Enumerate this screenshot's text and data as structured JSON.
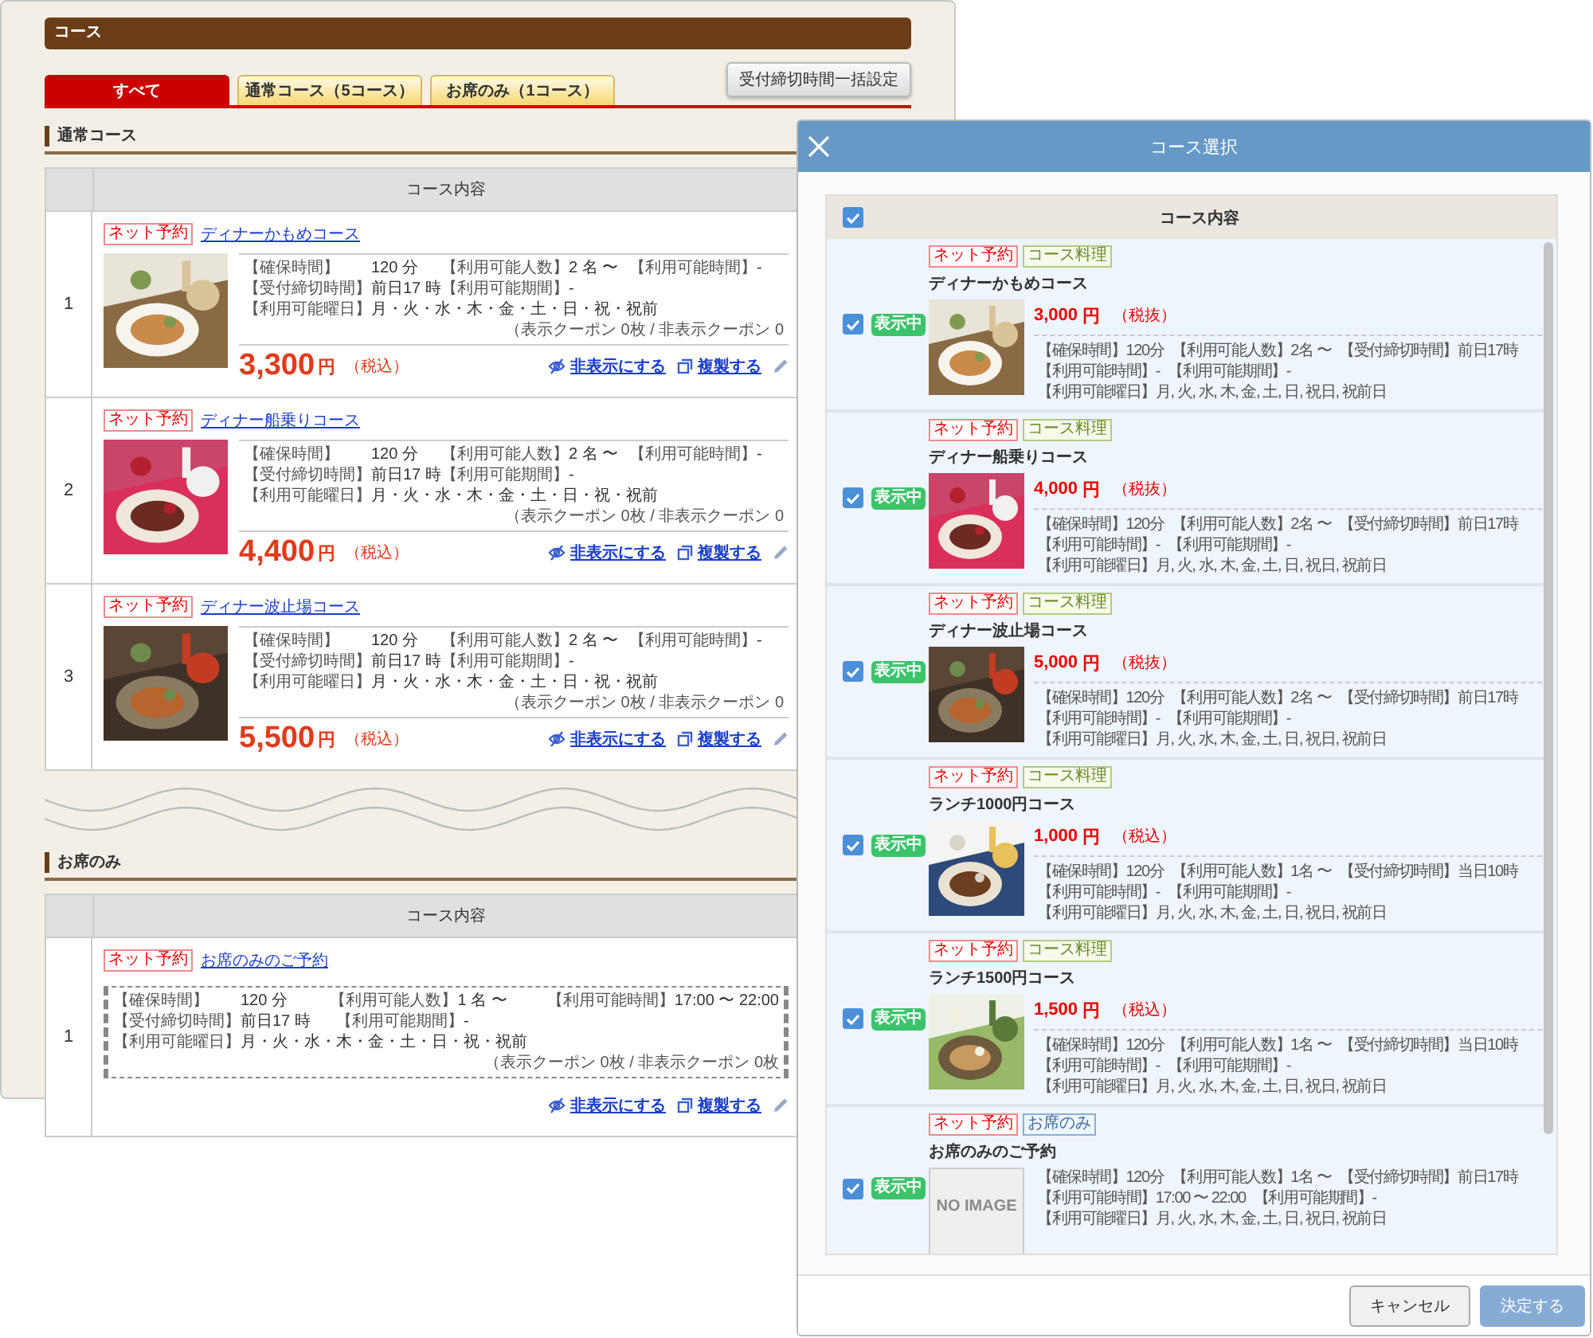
{
  "page": {
    "title": "コース",
    "tabs": [
      {
        "label": "すべて",
        "selected": true
      },
      {
        "label": "通常コース（5コース）",
        "selected": false
      },
      {
        "label": "お席のみ（1コース）",
        "selected": false
      }
    ],
    "bulk_button": "受付締切時間一括設定",
    "sections": [
      {
        "heading": "通常コース",
        "column_header": "コース内容",
        "rows": [
          {
            "number": "1",
            "tag": "ネット予約",
            "title": "ディナーかもめコース",
            "image": {
              "kind": "picture"
            },
            "info": [
              [
                {
                  "label": "【確保時間】",
                  "value": "120 分"
                },
                {
                  "label": "【利用可能人数】",
                  "value": "2 名 〜"
                },
                {
                  "label": "【利用可能時間】",
                  "value": "-"
                }
              ],
              [
                {
                  "label": "【受付締切時間】",
                  "value": "前日17 時"
                },
                {
                  "label": "【利用可能期間】",
                  "value": "-"
                }
              ],
              [
                {
                  "label": "【利用可能曜日】",
                  "value": "月・火・水・木・金・土・日・祝・祝前"
                }
              ]
            ],
            "coupon": "（表示クーポン 0枚 / 非表示クーポン 0",
            "price": "3,300",
            "currency": "円",
            "tax": "（税込）",
            "actions": [
              {
                "kind": "hide",
                "label": "非表示にする"
              },
              {
                "kind": "copy",
                "label": "複製する"
              },
              {
                "kind": "edit"
              }
            ]
          },
          {
            "number": "2",
            "tag": "ネット予約",
            "title": "ディナー船乗りコース",
            "image": {
              "kind": "picture"
            },
            "info": [
              [
                {
                  "label": "【確保時間】",
                  "value": "120 分"
                },
                {
                  "label": "【利用可能人数】",
                  "value": "2 名 〜"
                },
                {
                  "label": "【利用可能時間】",
                  "value": "-"
                }
              ],
              [
                {
                  "label": "【受付締切時間】",
                  "value": "前日17 時"
                },
                {
                  "label": "【利用可能期間】",
                  "value": "-"
                }
              ],
              [
                {
                  "label": "【利用可能曜日】",
                  "value": "月・火・水・木・金・土・日・祝・祝前"
                }
              ]
            ],
            "coupon": "（表示クーポン 0枚 / 非表示クーポン 0",
            "price": "4,400",
            "currency": "円",
            "tax": "（税込）",
            "actions": [
              {
                "kind": "hide",
                "label": "非表示にする"
              },
              {
                "kind": "copy",
                "label": "複製する"
              },
              {
                "kind": "edit"
              }
            ]
          },
          {
            "number": "3",
            "tag": "ネット予約",
            "title": "ディナー波止場コース",
            "image": {
              "kind": "picture"
            },
            "info": [
              [
                {
                  "label": "【確保時間】",
                  "value": "120 分"
                },
                {
                  "label": "【利用可能人数】",
                  "value": "2 名 〜"
                },
                {
                  "label": "【利用可能時間】",
                  "value": "-"
                }
              ],
              [
                {
                  "label": "【受付締切時間】",
                  "value": "前日17 時"
                },
                {
                  "label": "【利用可能期間】",
                  "value": "-"
                }
              ],
              [
                {
                  "label": "【利用可能曜日】",
                  "value": "月・火・水・木・金・土・日・祝・祝前"
                }
              ]
            ],
            "coupon": "（表示クーポン 0枚 / 非表示クーポン 0",
            "price": "5,500",
            "currency": "円",
            "tax": "（税込）",
            "actions": [
              {
                "kind": "hide",
                "label": "非表示にする"
              },
              {
                "kind": "copy",
                "label": "複製する"
              },
              {
                "kind": "edit"
              }
            ]
          }
        ]
      },
      {
        "heading": "お席のみ",
        "column_header": "コース内容",
        "rows": [
          {
            "number": "1",
            "tag": "ネット予約",
            "title": "お席のみのご予約",
            "info": [
              [
                {
                  "label": "【確保時間】",
                  "value": "120 分"
                },
                {
                  "label": "【利用可能人数】",
                  "value": "1 名 〜"
                },
                {
                  "label": "【利用可能時間】",
                  "value": "17:00 〜 22:00"
                }
              ],
              [
                {
                  "label": "【受付締切時間】",
                  "value": "前日17 時"
                },
                {
                  "label": "【利用可能期間】",
                  "value": "-"
                }
              ],
              [
                {
                  "label": "【利用可能曜日】",
                  "value": "月・火・水・木・金・土・日・祝・祝前"
                }
              ]
            ],
            "coupon": "（表示クーポン 0枚 / 非表示クーポン 0枚",
            "actions": [
              {
                "kind": "hide",
                "label": "非表示にする"
              },
              {
                "kind": "copy",
                "label": "複製する"
              },
              {
                "kind": "edit"
              }
            ]
          }
        ]
      }
    ]
  },
  "dialog": {
    "title": "コース選択",
    "header": {
      "checked": true,
      "label": "コース内容"
    },
    "courses": [
      {
        "checked": true,
        "status": "表示中",
        "tags": [
          {
            "label": "ネット予約",
            "kind": "net"
          },
          {
            "label": "コース料理",
            "kind": "course"
          }
        ],
        "title": "ディナーかもめコース",
        "image": {
          "kind": "picture"
        },
        "price": "3,000",
        "currency": "円",
        "tax": "（税抜）",
        "info": [
          [
            "【確保時間】120分",
            "【利用可能人数】2名 〜",
            "【受付締切時間】前日17時"
          ],
          [
            "【利用可能時間】-",
            "【利用可能期間】-"
          ],
          [
            "【利用可能曜日】月, 火, 水, 木, 金, 土, 日, 祝日, 祝前日"
          ]
        ]
      },
      {
        "checked": true,
        "status": "表示中",
        "tags": [
          {
            "label": "ネット予約",
            "kind": "net"
          },
          {
            "label": "コース料理",
            "kind": "course"
          }
        ],
        "title": "ディナー船乗りコース",
        "image": {
          "kind": "picture"
        },
        "price": "4,000",
        "currency": "円",
        "tax": "（税抜）",
        "info": [
          [
            "【確保時間】120分",
            "【利用可能人数】2名 〜",
            "【受付締切時間】前日17時"
          ],
          [
            "【利用可能時間】-",
            "【利用可能期間】-"
          ],
          [
            "【利用可能曜日】月, 火, 水, 木, 金, 土, 日, 祝日, 祝前日"
          ]
        ]
      },
      {
        "checked": true,
        "status": "表示中",
        "tags": [
          {
            "label": "ネット予約",
            "kind": "net"
          },
          {
            "label": "コース料理",
            "kind": "course"
          }
        ],
        "title": "ディナー波止場コース",
        "image": {
          "kind": "picture"
        },
        "price": "5,000",
        "currency": "円",
        "tax": "（税抜）",
        "info": [
          [
            "【確保時間】120分",
            "【利用可能人数】2名 〜",
            "【受付締切時間】前日17時"
          ],
          [
            "【利用可能時間】-",
            "【利用可能期間】-"
          ],
          [
            "【利用可能曜日】月, 火, 水, 木, 金, 土, 日, 祝日, 祝前日"
          ]
        ]
      },
      {
        "checked": true,
        "status": "表示中",
        "tags": [
          {
            "label": "ネット予約",
            "kind": "net"
          },
          {
            "label": "コース料理",
            "kind": "course"
          }
        ],
        "title": "ランチ1000円コース",
        "image": {
          "kind": "picture"
        },
        "price": "1,000",
        "currency": "円",
        "tax": "（税込）",
        "info": [
          [
            "【確保時間】120分",
            "【利用可能人数】1名 〜",
            "【受付締切時間】当日10時"
          ],
          [
            "【利用可能時間】-",
            "【利用可能期間】-"
          ],
          [
            "【利用可能曜日】月, 火, 水, 木, 金, 土, 日, 祝日, 祝前日"
          ]
        ]
      },
      {
        "checked": true,
        "status": "表示中",
        "tags": [
          {
            "label": "ネット予約",
            "kind": "net"
          },
          {
            "label": "コース料理",
            "kind": "course"
          }
        ],
        "title": "ランチ1500円コース",
        "image": {
          "kind": "picture"
        },
        "price": "1,500",
        "currency": "円",
        "tax": "（税込）",
        "info": [
          [
            "【確保時間】120分",
            "【利用可能人数】1名 〜",
            "【受付締切時間】当日10時"
          ],
          [
            "【利用可能時間】-",
            "【利用可能期間】-"
          ],
          [
            "【利用可能曜日】月, 火, 水, 木, 金, 土, 日, 祝日, 祝前日"
          ]
        ]
      },
      {
        "checked": true,
        "status": "表示中",
        "tags": [
          {
            "label": "ネット予約",
            "kind": "net"
          },
          {
            "label": "お席のみ",
            "kind": "seat"
          }
        ],
        "title": "お席のみのご予約",
        "image": {
          "kind": "placeholder",
          "text": "NO IMAGE"
        },
        "info": [
          [
            "【確保時間】120分",
            "【利用可能人数】1名 〜",
            "【受付締切時間】前日17時"
          ],
          [
            "【利用可能時間】17:00 〜 22:00",
            "【利用可能期間】-"
          ],
          [
            "【利用可能曜日】月, 火, 水, 木, 金, 土, 日, 祝日, 祝前日"
          ]
        ]
      }
    ],
    "buttons": [
      {
        "label": "キャンセル",
        "disabled": false
      },
      {
        "label": "決定する",
        "disabled": true
      }
    ]
  }
}
